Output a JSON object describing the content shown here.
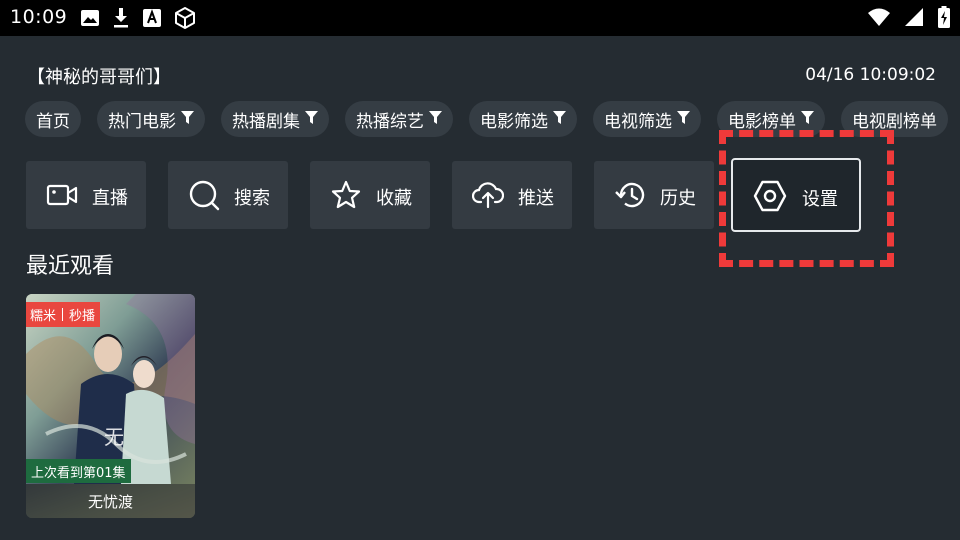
{
  "status_bar": {
    "time": "10:09",
    "left_icons": [
      "image-icon",
      "download-icon",
      "font-icon",
      "cube-icon"
    ],
    "right_icons": [
      "wifi-icon",
      "signal-icon",
      "battery-charging-icon"
    ]
  },
  "header": {
    "title": "【神秘的哥哥们】",
    "datetime": "04/16 10:09:02"
  },
  "tabs": [
    {
      "label": "首页",
      "filter": false
    },
    {
      "label": "热门电影",
      "filter": true
    },
    {
      "label": "热播剧集",
      "filter": true
    },
    {
      "label": "热播综艺",
      "filter": true
    },
    {
      "label": "电影筛选",
      "filter": true
    },
    {
      "label": "电视筛选",
      "filter": true
    },
    {
      "label": "电影榜单",
      "filter": true
    },
    {
      "label": "电视剧榜单",
      "filter": true
    }
  ],
  "actions": {
    "live": {
      "label": "直播",
      "icon": "video-camera-icon"
    },
    "search": {
      "label": "搜索",
      "icon": "search-icon"
    },
    "favorites": {
      "label": "收藏",
      "icon": "star-icon"
    },
    "push": {
      "label": "推送",
      "icon": "cloud-upload-icon"
    },
    "history": {
      "label": "历史",
      "icon": "history-icon"
    },
    "settings": {
      "label": "设置",
      "icon": "settings-icon"
    }
  },
  "recent": {
    "title": "最近观看",
    "items": [
      {
        "title": "无忧渡",
        "source_badge_1": "糯米",
        "source_badge_2": "秒播",
        "progress": "上次看到第01集"
      }
    ]
  },
  "colors": {
    "background": "#252c32",
    "button": "#343b42",
    "tab": "#353d44",
    "highlight": "#ef3a3a",
    "badge": "#e9473f",
    "progress_badge": "#1e6b3f"
  }
}
